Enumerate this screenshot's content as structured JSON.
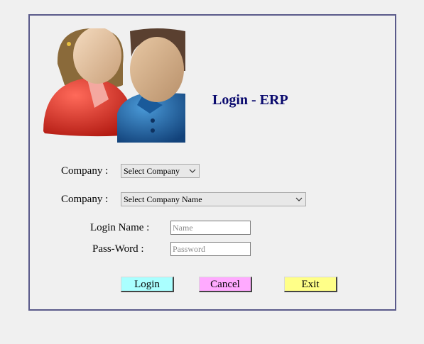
{
  "header": {
    "title": "Login - ERP",
    "avatar_icon": "users-icon"
  },
  "form": {
    "company_label_1": "Company :",
    "company_select_1": "Select Company",
    "company_label_2": "Company :",
    "company_select_2": "Select Company Name",
    "login_name_label": "Login Name :",
    "login_name_placeholder": "Name",
    "password_label": "Pass-Word :",
    "password_placeholder": "Password"
  },
  "buttons": {
    "login": "Login",
    "cancel": "Cancel",
    "exit": "Exit"
  },
  "colors": {
    "title": "#0a0a6e",
    "login_button": "#aaffff",
    "cancel_button": "#ffaaff",
    "exit_button": "#ffff88",
    "panel_border": "#5a5a8a"
  }
}
